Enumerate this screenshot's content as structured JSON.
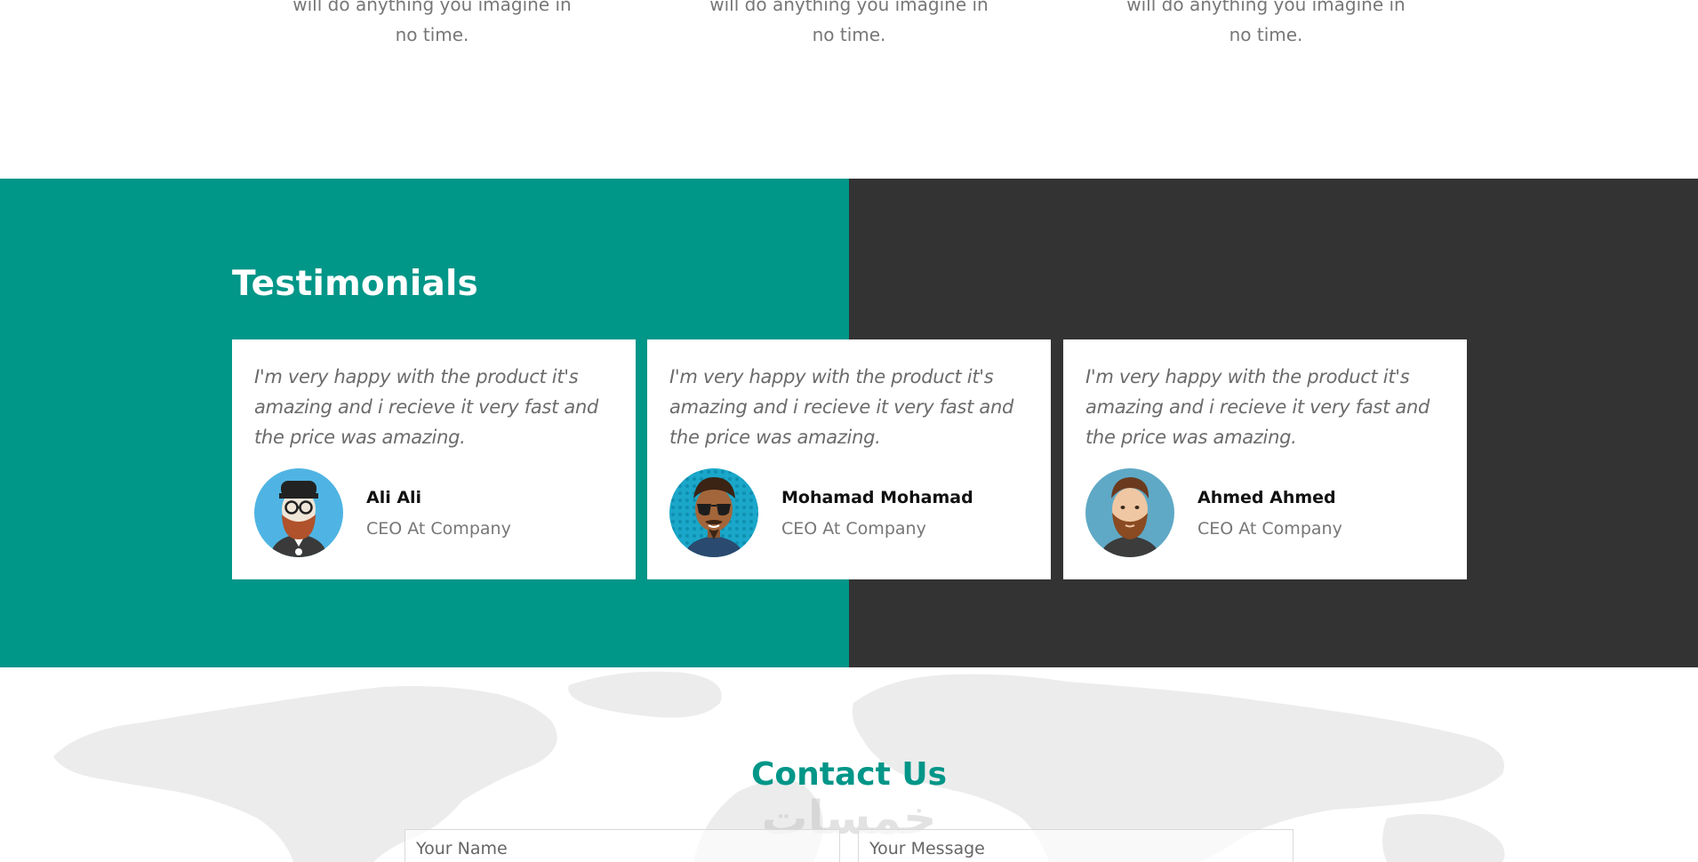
{
  "colors": {
    "accent": "#009688",
    "dark": "#333333",
    "text": "#777777"
  },
  "features": {
    "items": [
      {
        "text": "will do anything you imagine in no time."
      },
      {
        "text": "will do anything you imagine in no time."
      },
      {
        "text": "will do anything you imagine in no time."
      }
    ]
  },
  "testimonials": {
    "title": "Testimonials",
    "cards": [
      {
        "quote": "I'm very happy with the product it's amazing and i recieve it very fast and the price was amazing.",
        "name": "Ali Ali",
        "role": "CEO At Company",
        "avatar": "avatar-beard-glasses-icon"
      },
      {
        "quote": "I'm very happy with the product it's amazing and i recieve it very fast and the price was amazing.",
        "name": "Mohamad Mohamad",
        "role": "CEO At Company",
        "avatar": "avatar-sunglasses-icon"
      },
      {
        "quote": "I'm very happy with the product it's amazing and i recieve it very fast and the price was amazing.",
        "name": "Ahmed Ahmed",
        "role": "CEO At Company",
        "avatar": "avatar-beard-icon"
      }
    ]
  },
  "contact": {
    "title": "Contact Us",
    "watermark": "خمسات",
    "name_placeholder": "Your Name",
    "message_placeholder": "Your Message"
  }
}
